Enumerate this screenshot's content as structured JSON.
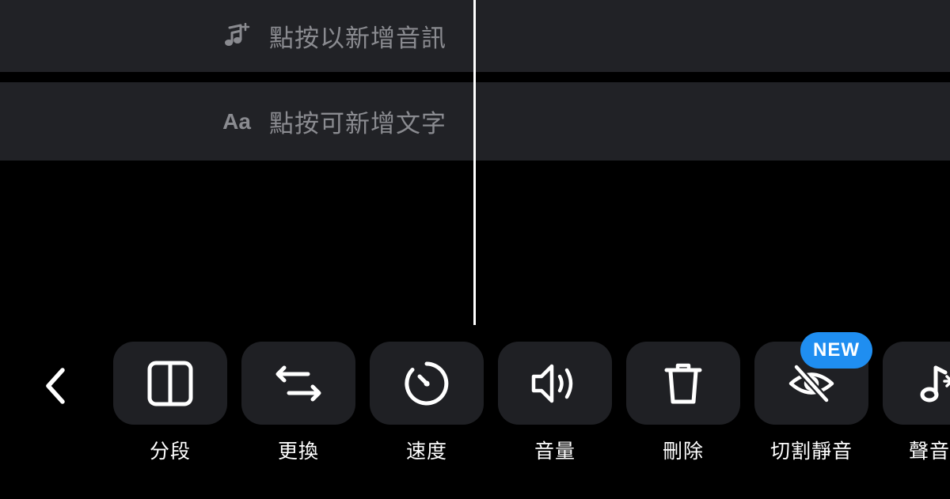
{
  "timeline": {
    "audio_track": {
      "hint": "點按以新增音訊",
      "icon": "music-note-plus-icon"
    },
    "text_track": {
      "hint": "點按可新增文字",
      "icon_text": "Aa"
    }
  },
  "toolbar": {
    "back_icon": "chevron-left-icon",
    "tools": [
      {
        "label": "分段",
        "icon": "split-icon"
      },
      {
        "label": "更換",
        "icon": "swap-arrows-icon"
      },
      {
        "label": "速度",
        "icon": "speed-dial-icon"
      },
      {
        "label": "音量",
        "icon": "speaker-volume-icon"
      },
      {
        "label": "刪除",
        "icon": "trash-icon"
      },
      {
        "label": "切割靜音",
        "icon": "eye-slash-icon",
        "badge": "NEW"
      },
      {
        "label": "聲音特",
        "icon": "music-note-sparkle-icon"
      }
    ]
  },
  "colors": {
    "background": "#000000",
    "track_bg": "#212226",
    "tool_bg": "#1f2024",
    "hint_text": "#8a8b90",
    "badge": "#1f8ef1",
    "playhead": "#ffffff"
  }
}
